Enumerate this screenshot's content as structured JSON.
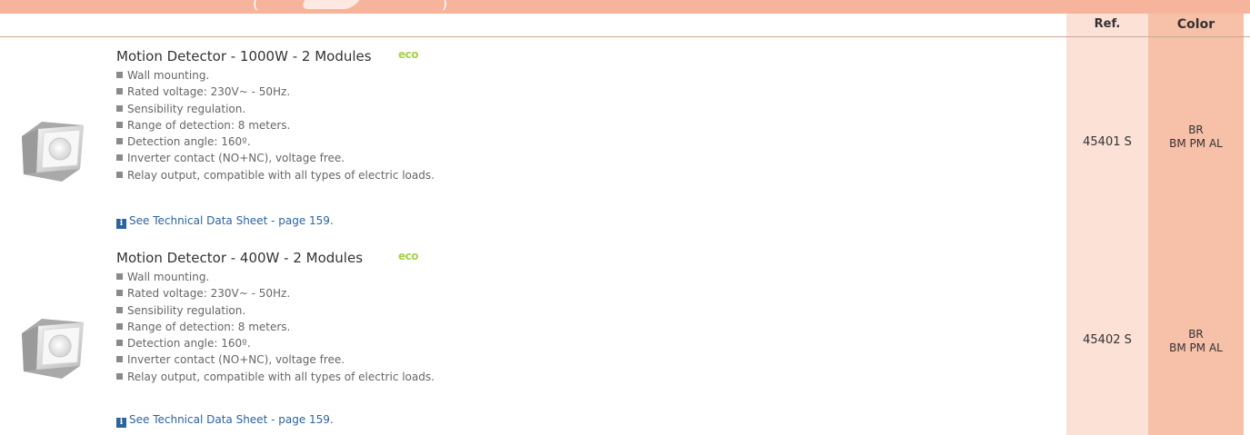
{
  "header": {
    "banner_partial_left": "(",
    "banner_partial_right": ")",
    "ref_label": "Ref.",
    "color_label": "Color"
  },
  "colors": {
    "banner": "#f6b49c",
    "ref_column": "#fbe1d6",
    "color_column": "#f6c0a9",
    "link": "#2c64a0",
    "eco_badge": "#a6d24a"
  },
  "products": [
    {
      "title": "Motion Detector - 1000W - 2 Modules",
      "badge": "eco",
      "features": [
        "Wall mounting.",
        "Rated voltage: 230V~ - 50Hz.",
        "Sensibility regulation.",
        "Range of detection: 8 meters.",
        "Detection angle: 160º.",
        "Inverter contact (NO+NC), voltage free.",
        "Relay output, compatible with all types of electric loads."
      ],
      "tds_icon": "i",
      "tds_link": "See Technical Data Sheet - page 159.",
      "ref": "45401 S",
      "color_line1": "BR",
      "color_line2": "BM PM AL"
    },
    {
      "title": "Motion Detector - 400W - 2 Modules",
      "badge": "eco",
      "features": [
        "Wall mounting.",
        "Rated voltage: 230V~ - 50Hz.",
        "Sensibility regulation.",
        "Range of detection: 8 meters.",
        "Detection angle: 160º.",
        "Inverter contact (NO+NC), voltage free.",
        "Relay output, compatible with all types of electric loads."
      ],
      "tds_icon": "i",
      "tds_link": "See Technical Data Sheet - page 159.",
      "ref": "45402 S",
      "color_line1": "BR",
      "color_line2": "BM PM AL"
    }
  ]
}
